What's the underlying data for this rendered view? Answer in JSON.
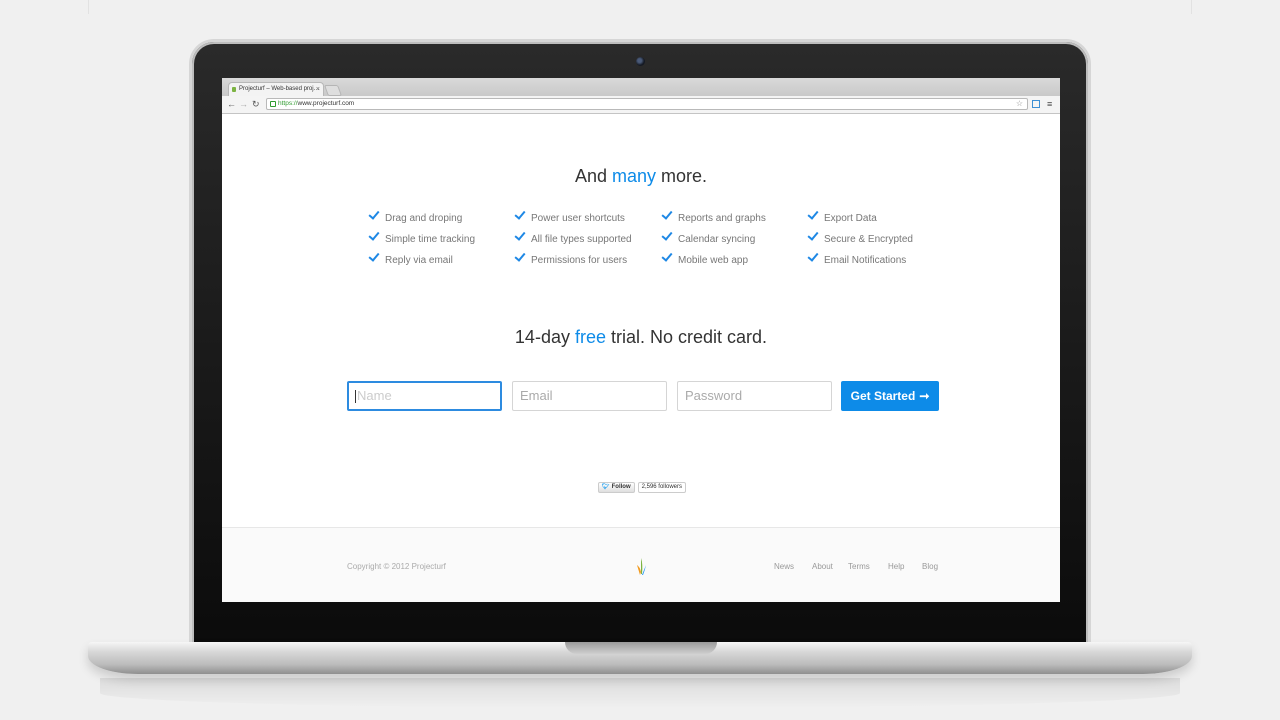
{
  "browser": {
    "tab_title": "Projecturf – Web-based proj…",
    "tab_close": "×",
    "url_scheme": "https://",
    "url_host": "www.projecturf.com"
  },
  "page": {
    "heading_prefix": "And ",
    "heading_accent": "many",
    "heading_suffix": " more.",
    "features": [
      [
        "Drag and droping",
        "Simple time tracking",
        "Reply via email"
      ],
      [
        "Power user shortcuts",
        "All file types supported",
        "Permissions for users"
      ],
      [
        "Reports and graphs",
        "Calendar syncing",
        "Mobile web app"
      ],
      [
        "Export Data",
        "Secure & Encrypted",
        "Email Notifications"
      ]
    ],
    "trial_prefix": "14-day ",
    "trial_accent": "free",
    "trial_suffix": " trial. No credit card.",
    "form": {
      "name_placeholder": "Name",
      "email_placeholder": "Email",
      "password_placeholder": "Password",
      "submit_label": "Get Started",
      "submit_arrow": "➞"
    },
    "twitter": {
      "follow_label": "Follow",
      "followers": "2,596 followers"
    }
  },
  "footer": {
    "copyright": "Copyright © 2012 Projecturf",
    "links": [
      "News",
      "About",
      "Terms",
      "Help",
      "Blog"
    ]
  },
  "colors": {
    "accent": "#0d8be8",
    "logo_green": "#7cb342",
    "logo_orange": "#f29a1f",
    "logo_blue": "#2196f3"
  }
}
